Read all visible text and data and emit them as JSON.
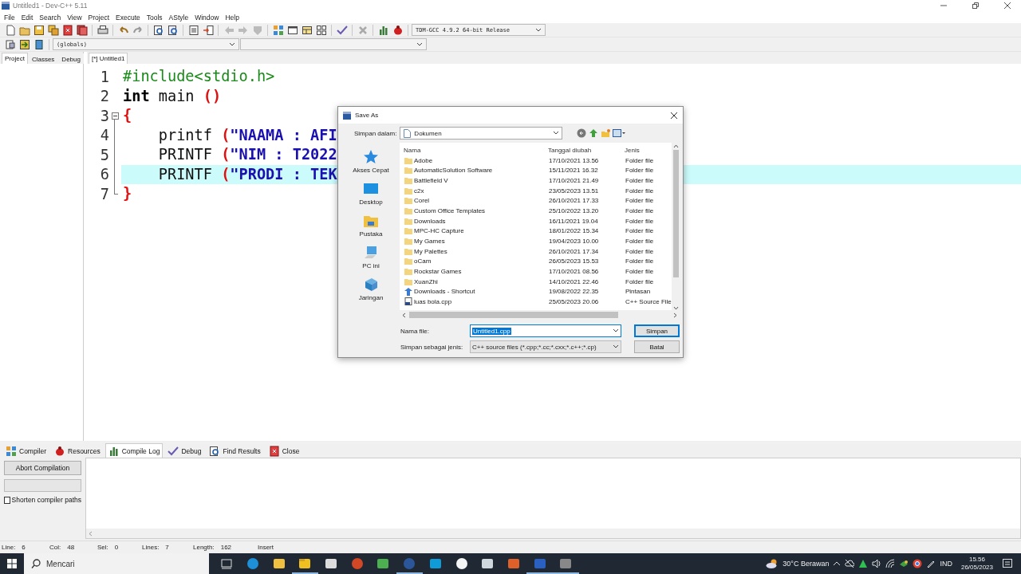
{
  "window": {
    "title": "Untitled1 - Dev-C++ 5.11"
  },
  "menu": [
    "File",
    "Edit",
    "Search",
    "View",
    "Project",
    "Execute",
    "Tools",
    "AStyle",
    "Window",
    "Help"
  ],
  "toolbar": {
    "compiler": "TDM-GCC 4.9.2 64-bit Release",
    "scope": "(globals)"
  },
  "left_panel": {
    "tabs": [
      {
        "label": "Project",
        "selected": true
      },
      {
        "label": "Classes",
        "selected": false
      },
      {
        "label": "Debug",
        "selected": false
      }
    ]
  },
  "editor": {
    "tabs": [
      {
        "label": "[*] Untitled1",
        "selected": true
      }
    ],
    "lines": [
      {
        "number": "1",
        "current": false,
        "tokens": [
          {
            "kind": "directive",
            "text": "#include<stdio.h>"
          }
        ]
      },
      {
        "number": "2",
        "current": false,
        "tokens": [
          {
            "kind": "keyword",
            "text": "int"
          },
          {
            "kind": "plain",
            "text": " main "
          },
          {
            "kind": "paren",
            "text": "()"
          }
        ]
      },
      {
        "number": "3",
        "current": false,
        "expanded": true,
        "tokens": [
          {
            "kind": "paren",
            "text": "{"
          }
        ],
        "children": [
          {
            "number": "4",
            "current": false,
            "tokens": [
              {
                "kind": "plain",
                "text": "    printf "
              },
              {
                "kind": "paren",
                "text": "("
              },
              {
                "kind": "string",
                "text": "\"NAAMA : AFI"
              }
            ]
          },
          {
            "number": "5",
            "current": false,
            "tokens": [
              {
                "kind": "plain",
                "text": "    PRINTF "
              },
              {
                "kind": "paren",
                "text": "("
              },
              {
                "kind": "string",
                "text": "\"NIM : T2022"
              }
            ]
          },
          {
            "number": "6",
            "current": true,
            "tokens": [
              {
                "kind": "plain",
                "text": "    PRINTF "
              },
              {
                "kind": "paren",
                "text": "("
              },
              {
                "kind": "string",
                "text": "\"PRODI : TEK"
              }
            ]
          },
          {
            "number": "7",
            "current": false,
            "tokens": [
              {
                "kind": "paren",
                "text": "}"
              }
            ]
          }
        ]
      }
    ]
  },
  "dialog": {
    "title": "Save As",
    "look_in_label": "Simpan dalam:",
    "look_in": "Dokumen",
    "places": [
      "Akses Cepat",
      "Desktop",
      "Pustaka",
      "PC ini",
      "Jaringan"
    ],
    "columns": [
      "Nama",
      "Tanggal diubah",
      "Jenis"
    ],
    "files": [
      {
        "kind": "folder",
        "name": "Adobe",
        "date": "17/10/2021 13.56",
        "type": "Folder file"
      },
      {
        "kind": "folder",
        "name": "AutomaticSolution Software",
        "date": "15/11/2021 16.32",
        "type": "Folder file"
      },
      {
        "kind": "folder",
        "name": "Battlefield V",
        "date": "17/10/2021 21.49",
        "type": "Folder file"
      },
      {
        "kind": "folder",
        "name": "c2x",
        "date": "23/05/2023 13.51",
        "type": "Folder file"
      },
      {
        "kind": "folder",
        "name": "Corel",
        "date": "26/10/2021 17.33",
        "type": "Folder file"
      },
      {
        "kind": "folder",
        "name": "Custom Office Templates",
        "date": "25/10/2022 13.20",
        "type": "Folder file"
      },
      {
        "kind": "folder",
        "name": "Downloads",
        "date": "16/11/2021 19.04",
        "type": "Folder file"
      },
      {
        "kind": "folder",
        "name": "MPC-HC Capture",
        "date": "18/01/2022 15.34",
        "type": "Folder file"
      },
      {
        "kind": "folder",
        "name": "My Games",
        "date": "19/04/2023 10.00",
        "type": "Folder file"
      },
      {
        "kind": "folder",
        "name": "My Palettes",
        "date": "26/10/2021 17.34",
        "type": "Folder file"
      },
      {
        "kind": "folder",
        "name": "oCam",
        "date": "26/05/2023 15.53",
        "type": "Folder file"
      },
      {
        "kind": "folder",
        "name": "Rockstar Games",
        "date": "17/10/2021 08.56",
        "type": "Folder file"
      },
      {
        "kind": "folder",
        "name": "XuanZhi",
        "date": "14/10/2021 22.46",
        "type": "Folder file"
      },
      {
        "kind": "shortcut",
        "name": "Downloads - Shortcut",
        "date": "19/08/2022 22.35",
        "type": "Pintasan"
      },
      {
        "kind": "source",
        "name": "luas bola.cpp",
        "date": "25/05/2023 20.06",
        "type": "C++ Source File"
      }
    ],
    "file_name_label": "Nama file:",
    "file_name": "Untitled1.cpp",
    "file_name_selected": true,
    "save_type_label": "Simpan sebagai jenis:",
    "save_type": "C++ source files (*.cpp;*.cc;*.cxx;*.c++;*.cp)",
    "buttons": [
      {
        "label": "Simpan",
        "default": true
      },
      {
        "label": "Batal",
        "default": false
      }
    ]
  },
  "bottom_panel": {
    "tabs": [
      {
        "label": "Compiler",
        "selected": false
      },
      {
        "label": "Resources",
        "selected": false
      },
      {
        "label": "Compile Log",
        "selected": true
      },
      {
        "label": "Debug",
        "selected": false
      },
      {
        "label": "Find Results",
        "selected": false
      },
      {
        "label": "Close",
        "selected": false
      }
    ],
    "abort_button": "Abort Compilation",
    "progress": {
      "level": 0
    },
    "checkbox": {
      "label": "Shorten compiler paths",
      "checked": false
    }
  },
  "status_bar": {
    "items": [
      {
        "label": "Line:",
        "value": "6"
      },
      {
        "label": "Col:",
        "value": "48"
      },
      {
        "label": "Sel:",
        "value": "0"
      },
      {
        "label": "Lines:",
        "value": "7"
      },
      {
        "label": "Length:",
        "value": "162"
      }
    ],
    "mode": "Insert"
  },
  "taskbar": {
    "search_placeholder": "Mencari",
    "apps": [
      {
        "running": false
      },
      {
        "running": false
      },
      {
        "running": false
      },
      {
        "running": true
      },
      {
        "running": false
      },
      {
        "running": false
      },
      {
        "running": false
      },
      {
        "running": true
      },
      {
        "running": false
      },
      {
        "running": false
      },
      {
        "running": false
      },
      {
        "running": false
      },
      {
        "running": true
      },
      {
        "running": true
      }
    ],
    "weather": "30°C Berawan",
    "language": "IND",
    "time": "15.56",
    "date": "26/05/2023"
  }
}
